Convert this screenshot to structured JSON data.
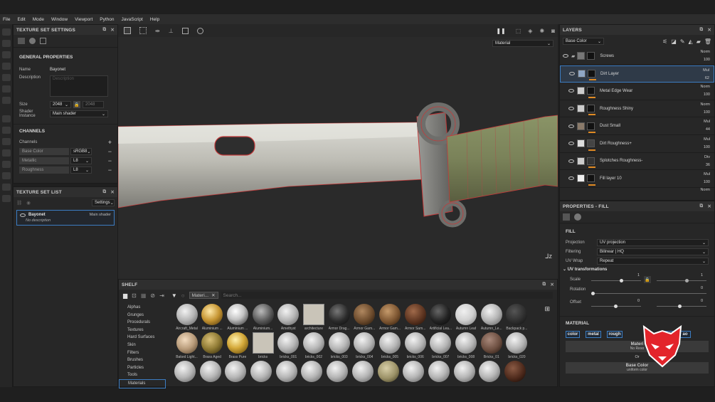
{
  "menu": [
    "File",
    "Edit",
    "Mode",
    "Window",
    "Viewport",
    "Python",
    "JavaScript",
    "Help"
  ],
  "texture_set_settings": {
    "title": "TEXTURE SET SETTINGS",
    "general_heading": "GENERAL PROPERTIES",
    "name_label": "Name",
    "name_value": "Bayonet",
    "description_label": "Description",
    "description_placeholder": "Description",
    "size_label": "Size",
    "size_w": "2048",
    "size_h": "2048",
    "shader_label": "Shader Instance",
    "shader_value": "Main shader",
    "channels_heading": "CHANNELS",
    "channels_label": "Channels",
    "channels": [
      {
        "name": "Base Color",
        "format": "sRGB8"
      },
      {
        "name": "Metallic",
        "format": "L8"
      },
      {
        "name": "Roughness",
        "format": "L8"
      }
    ]
  },
  "texture_set_list": {
    "title": "TEXTURE SET LIST",
    "settings_label": "Settings",
    "item_name": "Bayonet",
    "item_shader": "Main shader",
    "item_desc": "No description"
  },
  "viewport": {
    "material_mode": "Material"
  },
  "shelf": {
    "title": "SHELF",
    "filter_tag": "Materi...",
    "search_placeholder": "Search...",
    "categories": [
      "Alphas",
      "Grunges",
      "Procedurals",
      "Textures",
      "Hard Surfaces",
      "Skin",
      "Filters",
      "Brushes",
      "Particles",
      "Tools",
      "Materials"
    ],
    "selected_category": "Materials",
    "row1": [
      "Aircraft_Metal",
      "Aluminium ...",
      "Aluminium ...",
      "Aluminium...",
      "Amethyst",
      "architecture",
      "Armor Drag...",
      "Armor Gam...",
      "Armor Gam...",
      "Armor Sam...",
      "Artificial Lea...",
      "Autumn Leaf",
      "Autumn_Le...",
      "Backpack p..."
    ],
    "row2": [
      "Baked Light...",
      "Brass Aged",
      "Brass Pure",
      "bricks",
      "bricks_001",
      "bricks_002",
      "bricks_003",
      "bricks_004",
      "bricks_005",
      "bricks_006",
      "bricks_007",
      "bricks_008",
      "Bricks_01",
      "bricks_020"
    ]
  },
  "layers": {
    "title": "LAYERS",
    "channel_select": "Base Color",
    "items": [
      {
        "name": "Screws",
        "blend": "Norm",
        "opacity": "100"
      },
      {
        "name": "Dirt Layer",
        "blend": "Mul",
        "opacity": "62"
      },
      {
        "name": "Metal Edge Wear",
        "blend": "Norm",
        "opacity": "100"
      },
      {
        "name": "Roughness Shiny",
        "blend": "Norm",
        "opacity": "100"
      },
      {
        "name": "Dust Small",
        "blend": "Mul",
        "opacity": "44"
      },
      {
        "name": "Dirt Roughness+",
        "blend": "Mul",
        "opacity": "100"
      },
      {
        "name": "Splotches Roughness-",
        "blend": "Div",
        "opacity": "36"
      },
      {
        "name": "Fill layer 10",
        "blend": "Mul",
        "opacity": "100"
      }
    ],
    "last_blend": "Norm"
  },
  "properties": {
    "title": "PROPERTIES - FILL",
    "fill_heading": "FILL",
    "projection_label": "Projection",
    "projection_value": "UV projection",
    "filtering_label": "Filtering",
    "filtering_value": "Bilinear | HQ",
    "uvwrap_label": "UV Wrap",
    "uvwrap_value": "Repeat",
    "uvt_heading": "UV transformations",
    "scale_label": "Scale",
    "scale_value": "1",
    "scale_value2": "1",
    "rotation_label": "Rotation",
    "rotation_value": "0",
    "offset_label": "Offset",
    "offset_value": "0",
    "offset_value2": "0",
    "material_heading": "MATERIAL",
    "chips": [
      "color",
      "metal",
      "rough",
      "ht",
      "ao"
    ],
    "material_box": "Materi",
    "no_resource": "No Reso",
    "or_label": "Or",
    "base_color_title": "Base Color",
    "base_color_sub": "uniform color"
  },
  "colors": {
    "accent": "#3c7dc3",
    "selection": "#e08a23",
    "wireframe": "#d23b3b",
    "logo_red": "#e3242b"
  }
}
